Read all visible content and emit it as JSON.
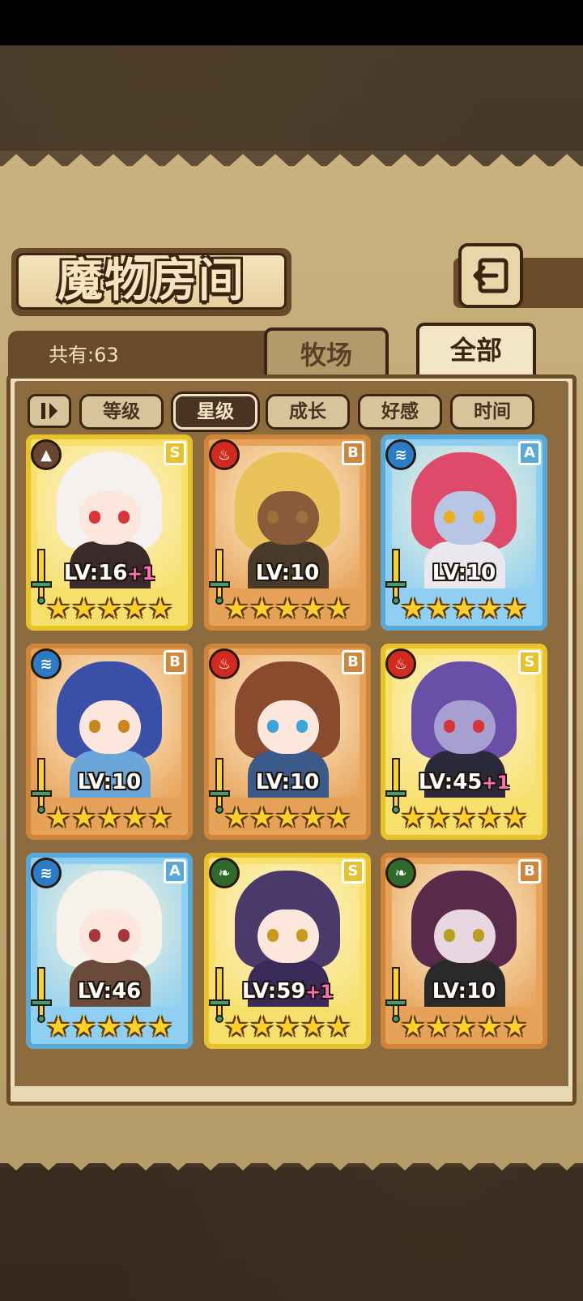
{
  "header": {
    "title": "魔物房间",
    "back_icon": "return-arrow-icon"
  },
  "summary": {
    "count_label": "共有:63"
  },
  "tabs": [
    {
      "label": "牧场",
      "active": false
    },
    {
      "label": "全部",
      "active": true
    }
  ],
  "filters": {
    "sort_toggle_icon": "sort-order-toggle-icon",
    "options": [
      {
        "label": "等级",
        "active": false
      },
      {
        "label": "星级",
        "active": true
      },
      {
        "label": "成长",
        "active": false
      },
      {
        "label": "好感",
        "active": false
      },
      {
        "label": "时间",
        "active": false
      }
    ]
  },
  "monsters": [
    {
      "element": "earth",
      "element_icon": "mountain-icon",
      "rank": "S",
      "frame": "gold",
      "lv": "LV:16",
      "plus": "+1",
      "stars": 5
    },
    {
      "element": "fire",
      "element_icon": "flame-icon",
      "rank": "B",
      "frame": "bronze",
      "lv": "LV:10",
      "plus": "",
      "stars": 5
    },
    {
      "element": "water",
      "element_icon": "water-waves-icon",
      "rank": "A",
      "frame": "blue",
      "lv": "LV:10",
      "plus": "",
      "stars": 5
    },
    {
      "element": "water",
      "element_icon": "water-waves-icon",
      "rank": "B",
      "frame": "bronze",
      "lv": "LV:10",
      "plus": "",
      "stars": 5
    },
    {
      "element": "fire",
      "element_icon": "flame-icon",
      "rank": "B",
      "frame": "bronze",
      "lv": "LV:10",
      "plus": "",
      "stars": 5
    },
    {
      "element": "fire",
      "element_icon": "flame-icon",
      "rank": "S",
      "frame": "gold",
      "lv": "LV:45",
      "plus": "+1",
      "stars": 5
    },
    {
      "element": "water",
      "element_icon": "water-waves-icon",
      "rank": "A",
      "frame": "blue",
      "lv": "LV:46",
      "plus": "",
      "stars": 5
    },
    {
      "element": "nature",
      "element_icon": "leaf-icon",
      "rank": "S",
      "frame": "gold",
      "lv": "LV:59",
      "plus": "+1",
      "stars": 5
    },
    {
      "element": "nature",
      "element_icon": "leaf-icon",
      "rank": "B",
      "frame": "bronze",
      "lv": "LV:10",
      "plus": "",
      "stars": 5
    }
  ],
  "colors": {
    "gold_frame": "#e8c22a",
    "bronze_frame": "#d0863a",
    "blue_frame": "#58a8d8",
    "fire": "#d22a1e",
    "water": "#2a7cc8",
    "earth": "#6a4632",
    "nature": "#2f6a2a",
    "star": "#ffcf2a",
    "plus": "#ff6fb5"
  }
}
